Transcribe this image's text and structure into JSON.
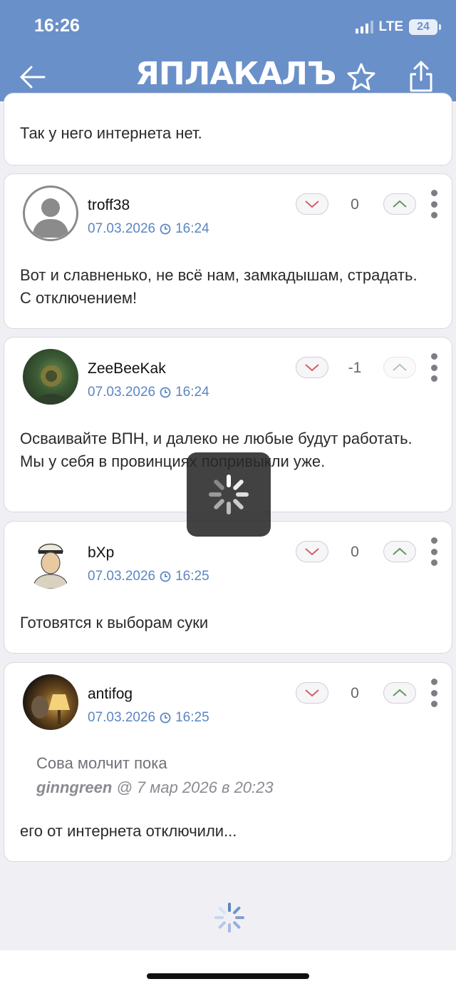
{
  "status_bar": {
    "time": "16:26",
    "network": "LTE",
    "battery": "24"
  },
  "header": {
    "logo": "ЯПЛАКАЛЪ",
    "back_icon": "arrow-left-icon",
    "favorite_icon": "star-icon",
    "share_icon": "share-icon"
  },
  "comments": [
    {
      "text": "Так у него интернета нет."
    },
    {
      "username": "troff38",
      "date": "07.03.2026",
      "time": "16:24",
      "score": "0",
      "text": "Вот и славненько, не всё нам, замкадышам, страдать. С отключением!"
    },
    {
      "username": "ZeeBeeKak",
      "date": "07.03.2026",
      "time": "16:24",
      "score": "-1",
      "text": "Осваивайте ВПН, и далеко не любые будут работать. Мы у себя в провинциях попривыкли уже."
    },
    {
      "username": "bXp",
      "date": "07.03.2026",
      "time": "16:25",
      "score": "0",
      "text": "Готовятся к выборам суки"
    },
    {
      "username": "antifog",
      "date": "07.03.2026",
      "time": "16:25",
      "score": "0",
      "quote": {
        "text": "Сова молчит пока",
        "author": "ginngreen",
        "meta": " @ 7 мар 2026 в 20:23"
      },
      "text": "его от интернета отключили..."
    }
  ]
}
